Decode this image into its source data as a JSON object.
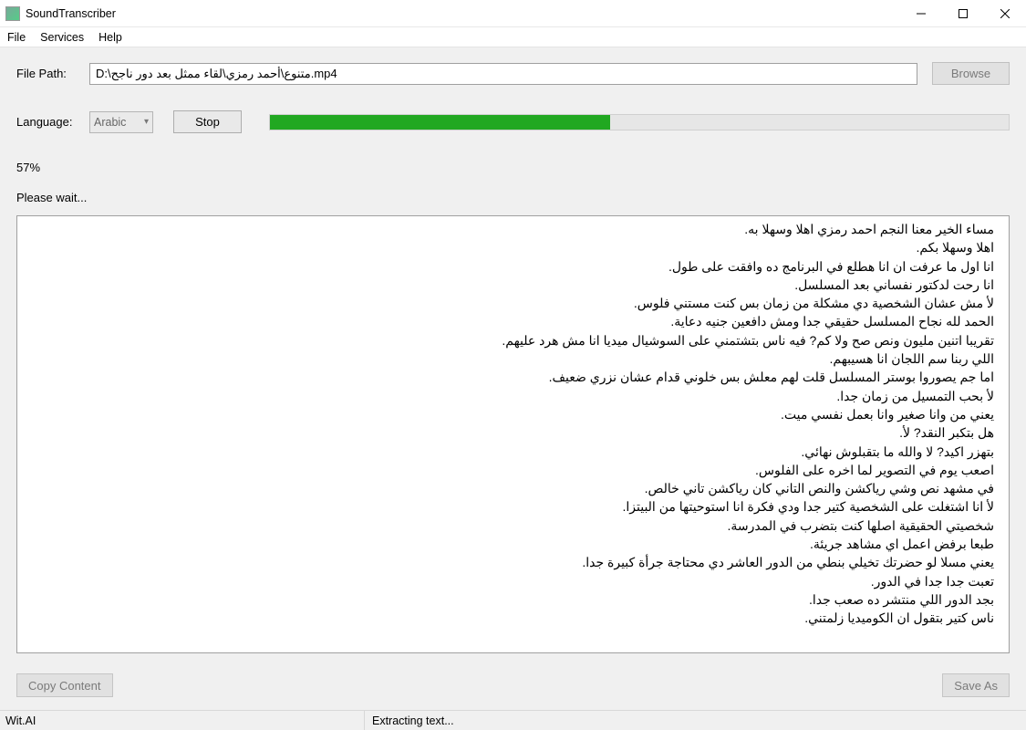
{
  "window": {
    "title": "SoundTranscriber"
  },
  "menu": {
    "file": "File",
    "services": "Services",
    "help": "Help"
  },
  "filepath": {
    "label": "File Path:",
    "value": "D:\\متنوع\\أحمد رمزي\\لقاء ممثل بعد دور ناجح.mp4",
    "browse": "Browse"
  },
  "language": {
    "label": "Language:",
    "value": "Arabic",
    "stop": "Stop"
  },
  "progress": {
    "percent_text": "57%",
    "percent_value": 46,
    "wait": "Please wait..."
  },
  "transcript_lines": [
    "مساء الخير معنا النجم احمد رمزي اهلا وسهلا به.",
    "اهلا وسهلا بكم.",
    "انا اول ما عرفت ان انا هطلع في البرنامج ده وافقت على طول.",
    "انا رحت لدكتور نفساني بعد المسلسل.",
    "لأ مش عشان الشخصية دي مشكلة من زمان بس كنت مستني فلوس.",
    "الحمد لله نجاح المسلسل حقيقي جدا ومش دافعين جنيه دعاية.",
    "تقريبا اتنين مليون ونص صح ولا كم? فيه ناس بتشتمني على السوشيال ميديا انا مش هرد عليهم.",
    "اللي ربنا سم اللجان  انا هسيبهم.",
    "اما جم يصوروا بوستر المسلسل قلت لهم معلش بس خلوني قدام عشان نزري ضعيف.",
    "لأ بحب التمسيل من زمان جدا.",
    "يعني من وانا صغير وانا بعمل نفسي ميت.",
    "هل بتكبر النقد? لأ.",
    "بتهزر اكيد? لا والله ما بتقبلوش نهائي.",
    "اصعب يوم في التصوير لما اخره على الفلوس.",
    "في مشهد نص وشي رياكشن والنص التاني كان رياكشن تاني خالص.",
    "لأ انا اشتغلت على الشخصية كتير جدا  ودي فكرة انا استوحيتها من البيتزا.",
    "شخصيتي الحقيقية اصلها كنت بتضرب في المدرسة.",
    "طبعا برفض اعمل اي مشاهد جريئة.",
    "يعني مسلا لو حضرتك تخيلي بنطي من الدور العاشر دي محتاجة جرأة كبيرة جدا.",
    "تعبت جدا جدا في الدور.",
    "بجد الدور اللي منتشر ده صعب جدا.",
    "ناس كتير بتقول ان الكوميديا زلمتني."
  ],
  "buttons": {
    "copy": "Copy Content",
    "save": "Save As"
  },
  "status": {
    "service": "Wit.AI",
    "activity": "Extracting text..."
  }
}
